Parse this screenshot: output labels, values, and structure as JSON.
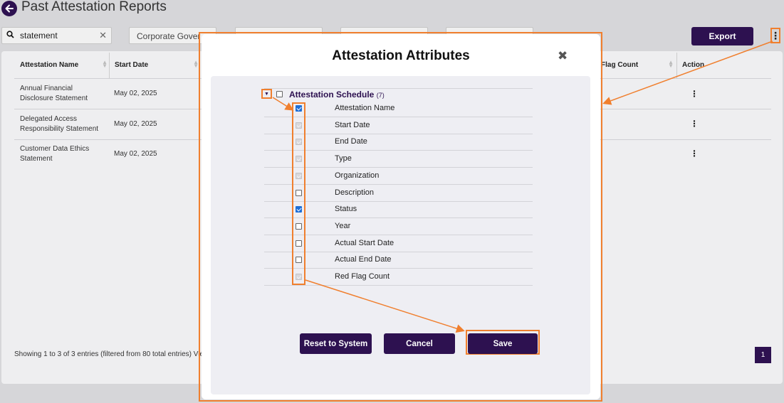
{
  "page": {
    "title": "Past Attestation Reports"
  },
  "toolbar": {
    "search_value": "statement",
    "filters": [
      "Corporate Gover",
      "",
      "",
      ""
    ],
    "export_label": "Export"
  },
  "table": {
    "columns": [
      "Attestation Name",
      "Start Date",
      "Flag Count",
      "Action"
    ],
    "rows": [
      {
        "name": "Annual Financial Disclosure Statement",
        "start_date": "May 02, 2025"
      },
      {
        "name": "Delegated Access Responsibility Statement",
        "start_date": "May 02, 2025"
      },
      {
        "name": "Customer Data Ethics Statement",
        "start_date": "May 02, 2025"
      }
    ],
    "footer": "Showing 1 to 3 of 3 entries (filtered from 80 total entries)   Vie",
    "page_number": "1"
  },
  "modal": {
    "title": "Attestation Attributes",
    "close_glyph": "✖",
    "group": {
      "label": "Attestation Schedule",
      "count": "(7)"
    },
    "attributes": [
      {
        "label": "Attestation Name",
        "state": "checked"
      },
      {
        "label": "Start Date",
        "state": "disabled"
      },
      {
        "label": "End Date",
        "state": "disabled"
      },
      {
        "label": "Type",
        "state": "disabled"
      },
      {
        "label": "Organization",
        "state": "disabled"
      },
      {
        "label": "Description",
        "state": "unchecked"
      },
      {
        "label": "Status",
        "state": "checked"
      },
      {
        "label": "Year",
        "state": "unchecked"
      },
      {
        "label": "Actual Start Date",
        "state": "unchecked"
      },
      {
        "label": "Actual End Date",
        "state": "unchecked"
      },
      {
        "label": "Red Flag Count",
        "state": "disabled"
      }
    ],
    "buttons": {
      "reset": "Reset to System",
      "cancel": "Cancel",
      "save": "Save"
    }
  },
  "colors": {
    "brand": "#2d1150",
    "highlight": "#f07f2e",
    "checkbox_checked": "#1f6fd6"
  }
}
